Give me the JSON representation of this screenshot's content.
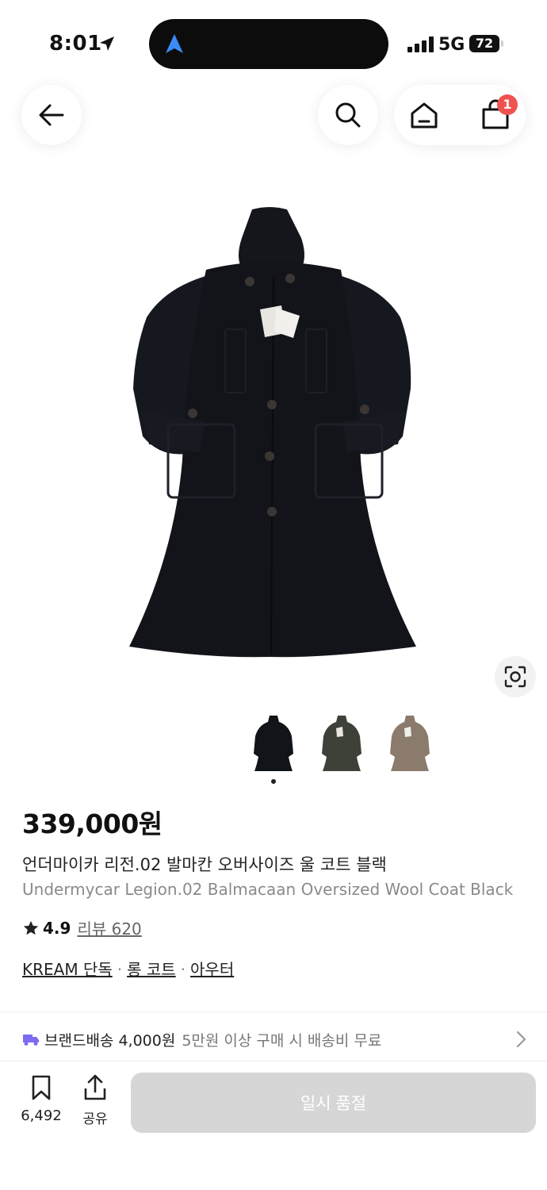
{
  "status_bar": {
    "time": "8:01",
    "network": "5G",
    "battery": "72"
  },
  "nav": {
    "cart_badge": "1"
  },
  "product": {
    "price": "339,000원",
    "name_ko": "언더마이카 리전.02 발마칸 오버사이즈 울 코트 블랙",
    "name_en": "Undermycar Legion.02 Balmacaan Oversized Wool Coat Black",
    "rating": "4.9",
    "reviews_label": "리뷰 620",
    "tags": [
      "KREAM 단독",
      "롱 코트",
      "아우터"
    ],
    "tag_separator": "·",
    "thumbnail_colors": [
      "#111418",
      "#3d4138",
      "#8b7b6c"
    ]
  },
  "delivery": {
    "label": "브랜드배송 4,000원",
    "note": "5만원 이상 구매 시 배송비 무료",
    "icon": "truck-icon",
    "icon_color": "#7b6cf0"
  },
  "bottom_bar": {
    "bookmark_count": "6,492",
    "share_label": "공유",
    "buy_button_label": "일시 품절"
  }
}
